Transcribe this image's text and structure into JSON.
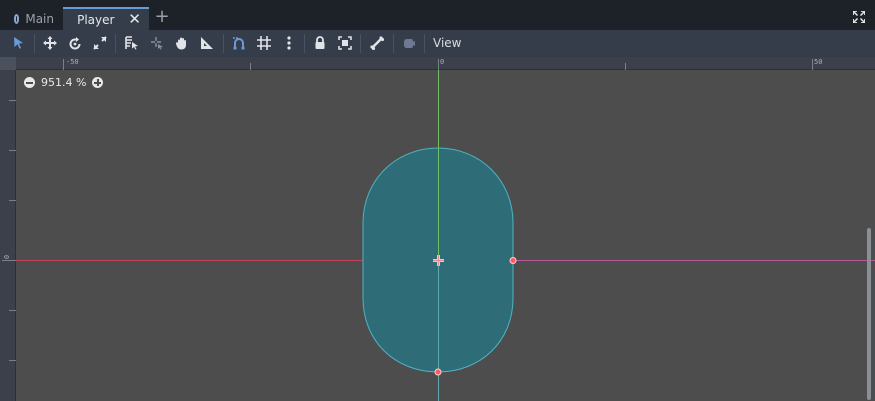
{
  "tabs": [
    {
      "label": "Main",
      "icon": "circle-icon",
      "active": false
    },
    {
      "label": "Player",
      "icon": "scene-node-icon",
      "active": true
    }
  ],
  "toolbar": {
    "view_label": "View",
    "tools": [
      "select-tool-icon",
      "move-tool-icon",
      "rotate-tool-icon",
      "scale-tool-icon",
      "selectable-list-icon",
      "pivot-tool-icon",
      "pan-tool-icon",
      "ruler-tool-icon",
      "smart-snap-icon",
      "grid-snap-icon",
      "more-options-icon",
      "lock-icon",
      "group-icon",
      "bone-icon",
      "camera-override-icon"
    ]
  },
  "viewport": {
    "zoom": "951.4 %",
    "ruler_top_labels": [
      "-50",
      "0",
      "50"
    ],
    "ruler_left_labels": [
      "0"
    ]
  },
  "colors": {
    "accent": "#6b9bd6",
    "shape_fill": "#2e6c78",
    "shape_stroke": "#4fb3c2",
    "x_axis": "#c2455a",
    "y_axis": "#6fbf63",
    "handle": "#ff5a5a"
  }
}
